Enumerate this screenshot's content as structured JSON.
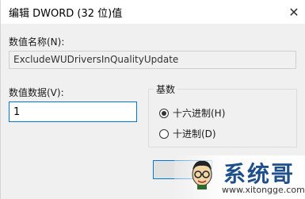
{
  "window": {
    "title": "编辑 DWORD (32 位)值",
    "close_glyph": "✕"
  },
  "name_field": {
    "label": "数值名称(N):",
    "value": "ExcludeWUDriversInQualityUpdate"
  },
  "data_field": {
    "label": "数值数据(V):",
    "value": "1"
  },
  "base_group": {
    "legend": "基数",
    "options": [
      {
        "label": "十六进制(H)",
        "selected": true
      },
      {
        "label": "十进制(D)",
        "selected": false
      }
    ]
  },
  "buttons": {
    "ok_label": ""
  },
  "watermark": {
    "title": "系统哥",
    "url": "www.xitongge.com"
  }
}
